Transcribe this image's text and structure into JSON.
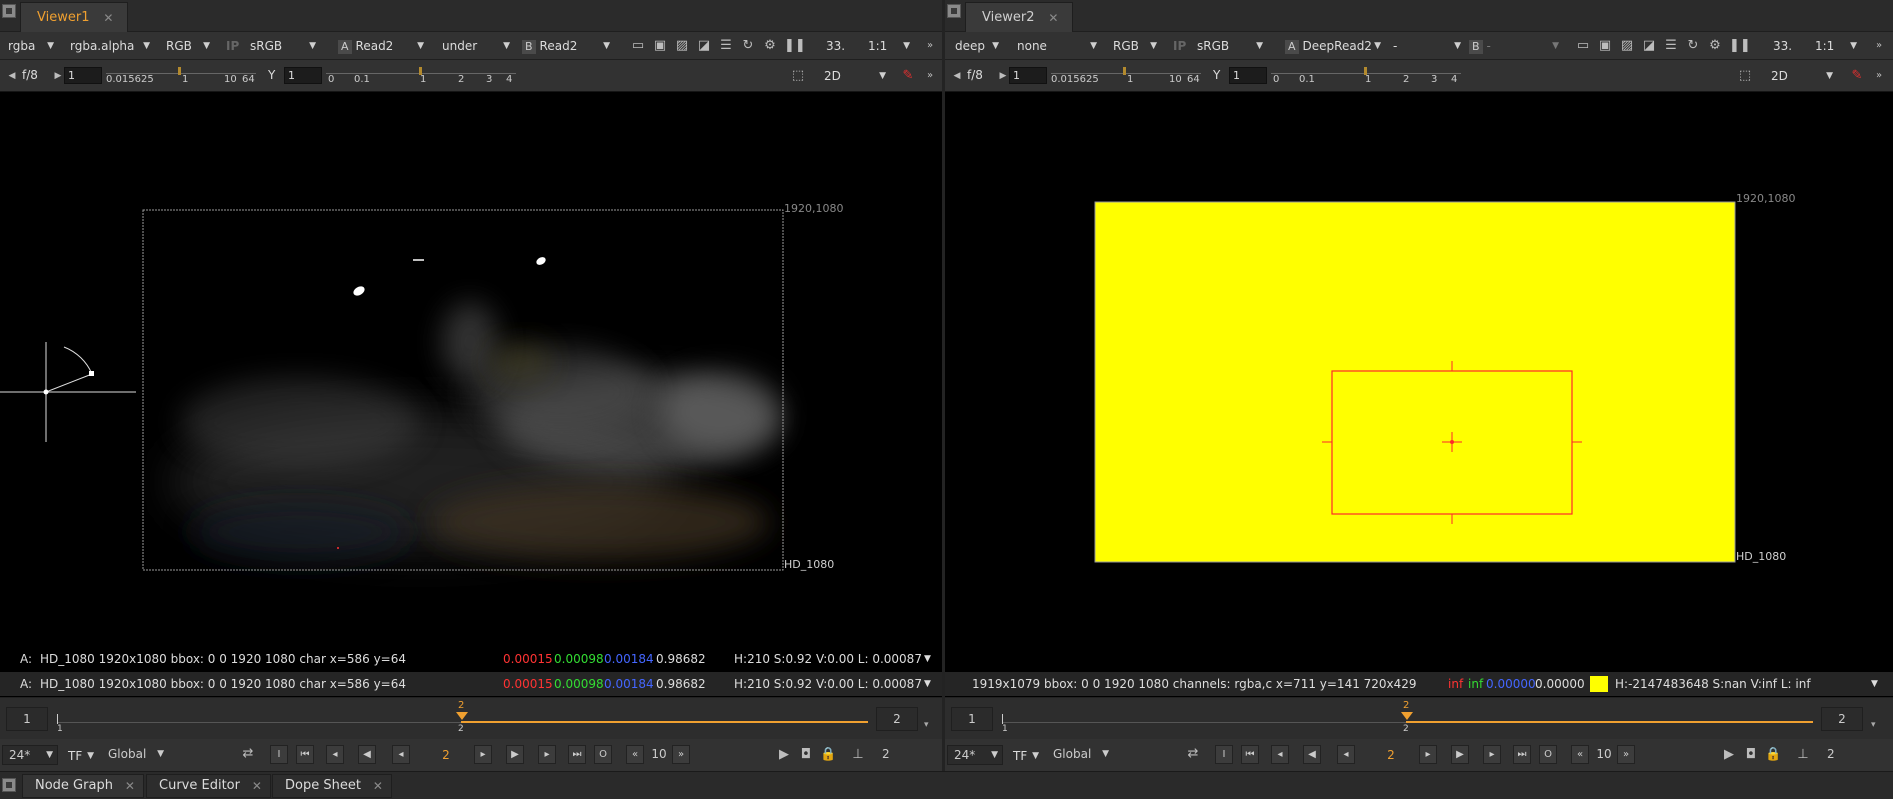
{
  "viewer1": {
    "tab_label": "Viewer1",
    "toolbar": {
      "channels": "rgba",
      "channel_alpha": "rgba.alpha",
      "display": "RGB",
      "ip": "IP",
      "colorspace": "sRGB",
      "a_label": "A",
      "input_a": "Read2",
      "wipe_mode": "under",
      "b_label": "B",
      "input_b": "Read2",
      "zoom_pct": "33.",
      "scale": "1:1"
    },
    "toolbar2": {
      "fstop": "f/8",
      "gain_value": "1",
      "gain_ticks": [
        "0.015625",
        "1",
        "10",
        "64"
      ],
      "gamma_label": "Y",
      "gamma_value": "1",
      "gamma_ticks": [
        "0",
        "0.1",
        "1",
        "2",
        "3",
        "4"
      ],
      "view_mode": "2D"
    },
    "format_label": "HD_1080",
    "format_size": "1920,1080",
    "status_line_1": {
      "prefix": "A:",
      "info": "HD_1080 1920x1080  bbox: 0 0 1920 1080 char  x=586 y=64",
      "r": "0.00015",
      "g": "0.00098",
      "b": "0.00184",
      "a": "0.98682",
      "hsv": "H:210 S:0.92 V:0.00  L: 0.00087"
    },
    "status_line_2": {
      "prefix": "A:",
      "info": "HD_1080 1920x1080  bbox: 0 0 1920 1080 char  x=586 y=64",
      "r": "0.00015",
      "g": "0.00098",
      "b": "0.00184",
      "a": "0.98682",
      "hsv": "H:210 S:0.92 V:0.00  L: 0.00087"
    },
    "timeline": {
      "start": "1",
      "end": "2",
      "marker_start": "1",
      "marker_current": "2"
    },
    "controls": {
      "fps": "24*",
      "tf": "TF",
      "range": "Global",
      "frame": "2",
      "step": "10",
      "end_frame": "2"
    }
  },
  "viewer2": {
    "tab_label": "Viewer2",
    "toolbar": {
      "channels": "deep",
      "channel_alpha": "none",
      "display": "RGB",
      "ip": "IP",
      "colorspace": "sRGB",
      "a_label": "A",
      "input_a": "DeepRead2",
      "wipe_mode": "-",
      "b_label": "B",
      "input_b": "-",
      "zoom_pct": "33.",
      "scale": "1:1"
    },
    "toolbar2": {
      "fstop": "f/8",
      "gain_value": "1",
      "gain_ticks": [
        "0.015625",
        "1",
        "10",
        "64"
      ],
      "gamma_label": "Y",
      "gamma_value": "1",
      "gamma_ticks": [
        "0",
        "0.1",
        "1",
        "2",
        "3",
        "4"
      ],
      "view_mode": "2D"
    },
    "format_label": "HD_1080",
    "format_size": "1920,1080",
    "status_line": {
      "info": "1919x1079  bbox: 0 0 1920 1080 channels: rgba,c  x=711 y=141 720x429",
      "r": "inf",
      "g": "inf",
      "b": "0.00000",
      "a": "0.00000",
      "swatch_color": "#ffff00",
      "hsv": "H:-2147483648 S:nan V:inf  L: inf"
    },
    "timeline": {
      "start": "1",
      "end": "2",
      "marker_start": "1",
      "marker_current": "2"
    },
    "controls": {
      "fps": "24*",
      "tf": "TF",
      "range": "Global",
      "frame": "2",
      "step": "10",
      "end_frame": "2"
    }
  },
  "bottom_tabs": [
    "Node Graph",
    "Curve Editor",
    "Dope Sheet"
  ],
  "colors": {
    "accent": "#f0a030",
    "frame_fill": "#ffff00",
    "selection": "#ff2a2a"
  }
}
